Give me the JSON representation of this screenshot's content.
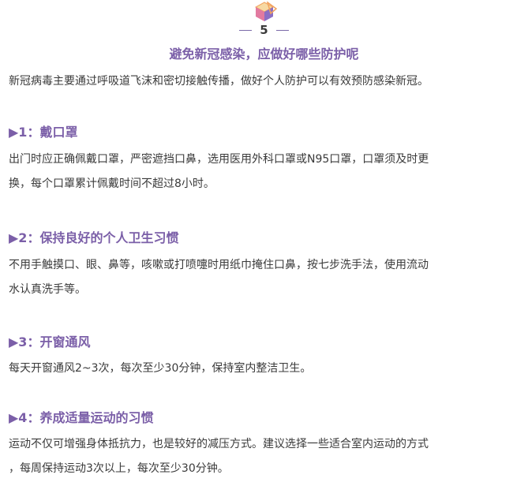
{
  "section": {
    "number": "5",
    "title": "避免新冠感染，应做好哪些防护呢",
    "intro": "新冠病毒主要通过呼吸道飞沫和密切接触传播，做好个人防护可以有效预防感染新冠。"
  },
  "colors": {
    "accent": "#7b5fa8",
    "text": "#3a3a3a",
    "icon_orange": "#f2a35e",
    "icon_pink": "#e27aa0",
    "icon_purple": "#8b6fc4"
  },
  "icon": "colorful-cube-icon",
  "items": [
    {
      "heading": "▶1：戴口罩",
      "lines": [
        "出门时应正确佩戴口罩，严密遮挡口鼻，选用医用外科口罩或N95口罩，口罩须及时更",
        "换，每个口罩累计佩戴时间不超过8小时。"
      ]
    },
    {
      "heading": "▶2：保持良好的个人卫生习惯",
      "lines": [
        "不用手触摸口、眼、鼻等，咳嗽或打喷嚏时用纸巾掩住口鼻，按七步洗手法，使用流动",
        "水认真洗手等。"
      ]
    },
    {
      "heading": "▶3：开窗通风",
      "lines": [
        "每天开窗通风2~3次，每次至少30分钟，保持室内整洁卫生。"
      ]
    },
    {
      "heading": "▶4：养成适量运动的习惯",
      "lines": [
        "运动不仅可增强身体抵抗力，也是较好的减压方式。建议选择一些适合室内运动的方式",
        "，每周保持运动3次以上，每次至少30分钟。"
      ]
    }
  ]
}
